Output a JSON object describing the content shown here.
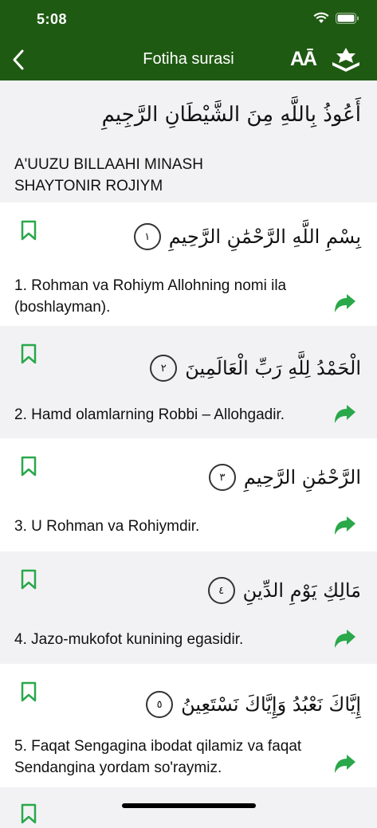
{
  "status": {
    "time": "5:08"
  },
  "header": {
    "title": "Fotiha surasi",
    "font_label": "AĀ"
  },
  "intro": {
    "arabic": "أَعُوذُ بِاللَّهِ مِنَ الشَّيْطَانِ الرَّجِيمِ",
    "translit": "A'UUZU BILLAAHI MINASH\nSHAYTONIR ROJIYM"
  },
  "verses": [
    {
      "num": "١",
      "arabic": "بِسْمِ اللَّهِ الرَّحْمَٰنِ الرَّحِيمِ",
      "text": "1. Rohman va Rohiym Allohning nomi ila (boshlayman)."
    },
    {
      "num": "٢",
      "arabic": "الْحَمْدُ لِلَّهِ رَبِّ الْعَالَمِينَ",
      "text": "2. Hamd olamlarning Robbi – Allohgadir."
    },
    {
      "num": "٣",
      "arabic": "الرَّحْمَٰنِ الرَّحِيمِ",
      "text": "3. U Rohman va Rohiymdir."
    },
    {
      "num": "٤",
      "arabic": "مَالِكِ يَوْمِ الدِّينِ",
      "text": "4. Jazo-mukofot kunining egasidir."
    },
    {
      "num": "٥",
      "arabic": "إِيَّاكَ نَعْبُدُ وَإِيَّاكَ نَسْتَعِينُ",
      "text": "5. Faqat Sengagina ibodat qilamiz va faqat Sendangina yordam so'raymiz."
    }
  ],
  "colors": {
    "header": "#1f5a12",
    "accent": "#2aa84a"
  }
}
